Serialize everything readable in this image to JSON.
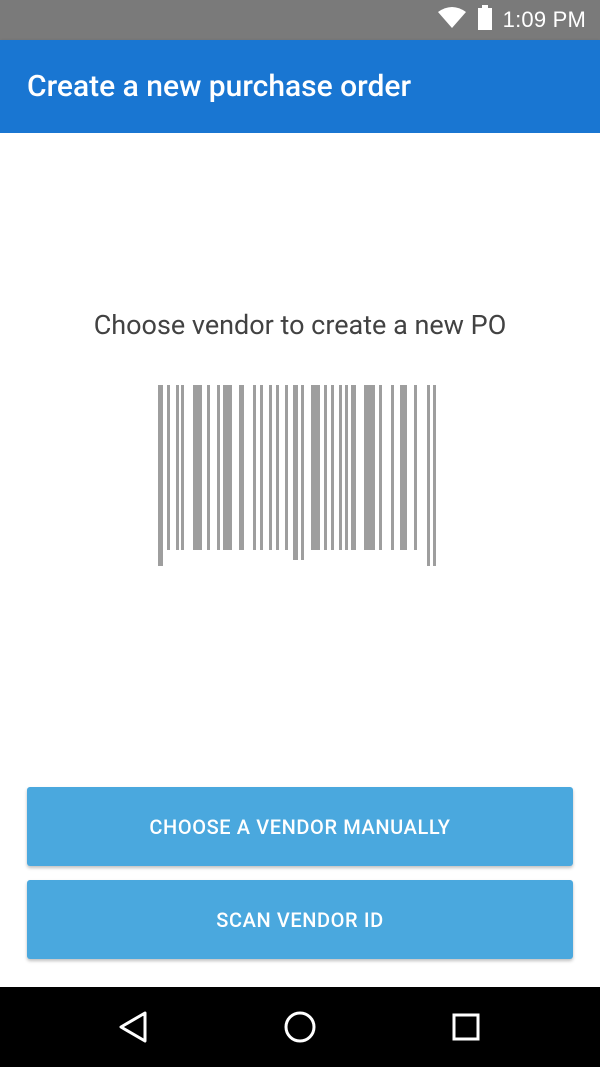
{
  "status_bar": {
    "time": "1:09 PM",
    "icons": [
      "wifi-icon",
      "battery-icon"
    ]
  },
  "app_bar": {
    "title": "Create a new purchase order"
  },
  "main": {
    "prompt": "Choose vendor to create a new PO",
    "barcode_icon": "barcode-icon"
  },
  "actions": {
    "choose_manually_label": "CHOOSE A VENDOR MANUALLY",
    "scan_vendor_label": "SCAN VENDOR ID"
  },
  "nav_bar": {
    "icons": [
      "back-icon",
      "home-icon",
      "recents-icon"
    ]
  },
  "colors": {
    "status_bar": "#7a7a7a",
    "app_bar": "#1976d2",
    "button": "#4aa8de",
    "nav_bar": "#000000",
    "barcode": "#9e9e9e"
  }
}
